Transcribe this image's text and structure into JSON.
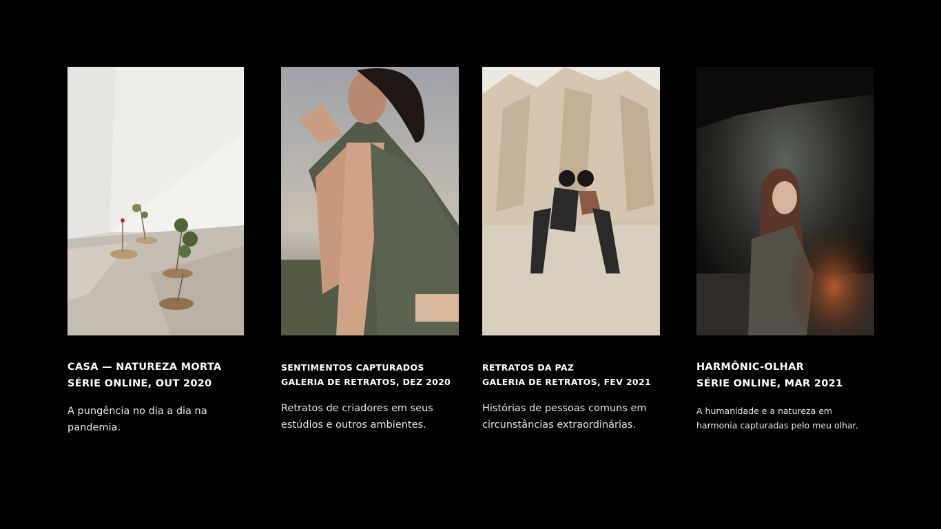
{
  "cards": [
    {
      "title_line1": "CASA — NATUREZA MORTA",
      "title_line2": "SÉRIE ONLINE, OUT 2020",
      "description": "A pungência no dia a dia na pandemia."
    },
    {
      "title_line1": "SENTIMENTOS CAPTURADOS",
      "title_line2": "GALERIA DE RETRATOS, DEZ 2020",
      "description": "Retratos de criadores em seus estúdios e outros ambientes."
    },
    {
      "title_line1": "RETRATOS DA PAZ",
      "title_line2": "GALERIA DE RETRATOS, FEV 2021",
      "description": "Histórias de pessoas comuns em circunstâncias extraordinárias."
    },
    {
      "title_line1": "HARMÔNIC-OLHAR",
      "title_line2": "SÉRIE ONLINE, MAR 2021",
      "description": "A humanidade e a natureza em harmonia capturadas pelo meu olhar."
    }
  ],
  "colors": {
    "background": "#000000",
    "text": "#ffffff"
  }
}
